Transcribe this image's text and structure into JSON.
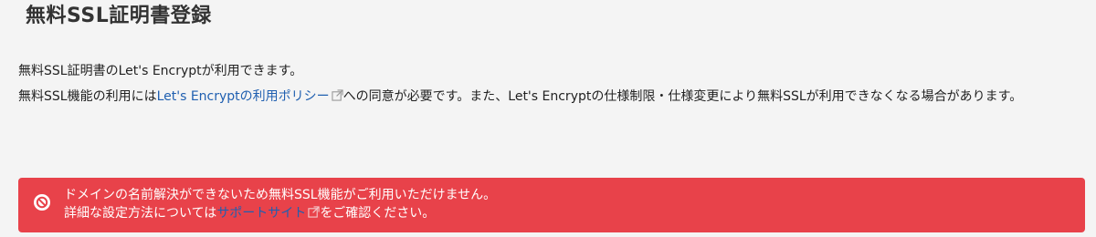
{
  "page": {
    "title": "無料SSL証明書登録"
  },
  "description": {
    "line1": "無料SSL証明書のLet's Encryptが利用できます。",
    "line2_prefix": "無料SSL機能の利用には",
    "policy_link": "Let's Encryptの利用ポリシー",
    "line2_suffix": "への同意が必要です。また、Let's Encryptの仕様制限・仕様変更により無料SSLが利用できなくなる場合があります。"
  },
  "alert": {
    "icon": "prohibited-icon",
    "line1": "ドメインの名前解決ができないため無料SSL機能がご利用いただけません。",
    "line2_prefix": "詳細な設定方法については",
    "support_link": "サポートサイト",
    "line2_suffix": "をご確認ください。"
  },
  "colors": {
    "alert_background": "#e8424a",
    "link": "#1f5fb0",
    "page_background": "#f4f4f4"
  }
}
